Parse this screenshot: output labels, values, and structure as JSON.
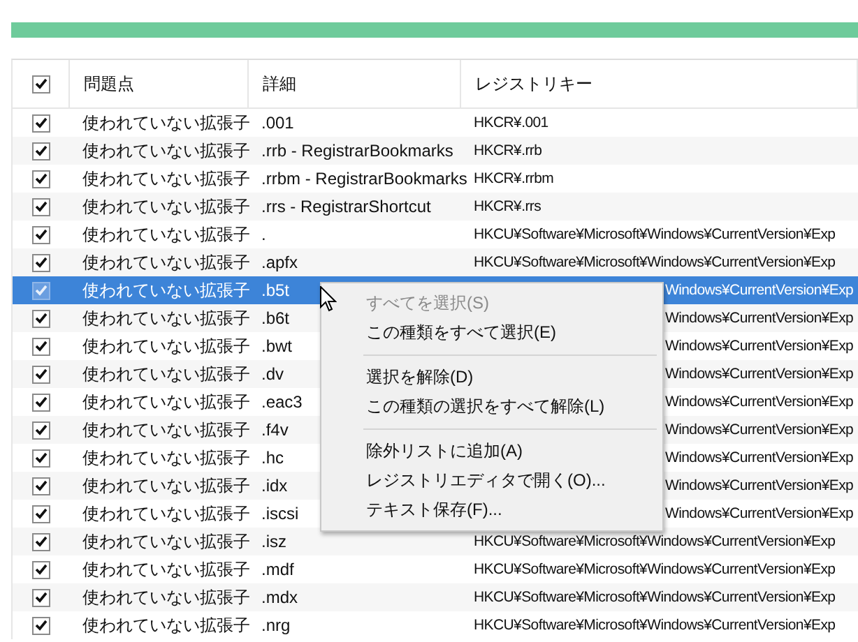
{
  "progress": {
    "level": 1
  },
  "table": {
    "header_checked": true,
    "columns": [
      "問題点",
      "詳細",
      "レジストリキー"
    ],
    "rows": [
      {
        "kind": "full",
        "checked": true,
        "selected": false,
        "problem": "使われていない拡張子",
        "detail": ".001",
        "key": "HKCR¥.001"
      },
      {
        "kind": "full",
        "checked": true,
        "selected": false,
        "problem": "使われていない拡張子",
        "detail": ".rrb - RegistrarBookmarks",
        "key": "HKCR¥.rrb"
      },
      {
        "kind": "full",
        "checked": true,
        "selected": false,
        "problem": "使われていない拡張子",
        "detail": ".rrbm - RegistrarBookmarks",
        "key": "HKCR¥.rrbm"
      },
      {
        "kind": "full",
        "checked": true,
        "selected": false,
        "problem": "使われていない拡張子",
        "detail": ".rrs - RegistrarShortcut",
        "key": "HKCR¥.rrs"
      },
      {
        "kind": "full",
        "checked": true,
        "selected": false,
        "problem": "使われていない拡張子",
        "detail": ".",
        "key": "HKCU¥Software¥Microsoft¥Windows¥CurrentVersion¥Exp"
      },
      {
        "kind": "full",
        "checked": true,
        "selected": false,
        "problem": "使われていない拡張子",
        "detail": ".apfx",
        "key": "HKCU¥Software¥Microsoft¥Windows¥CurrentVersion¥Exp"
      },
      {
        "kind": "covered",
        "checked": true,
        "selected": true,
        "problem": "使われていない拡張子",
        "detail": ".b5t",
        "key": "Windows¥CurrentVersion¥Exp"
      },
      {
        "kind": "covered",
        "checked": true,
        "selected": false,
        "problem": "使われていない拡張子",
        "detail": ".b6t",
        "key": "Windows¥CurrentVersion¥Exp"
      },
      {
        "kind": "covered",
        "checked": true,
        "selected": false,
        "problem": "使われていない拡張子",
        "detail": ".bwt",
        "key": "Windows¥CurrentVersion¥Exp"
      },
      {
        "kind": "covered",
        "checked": true,
        "selected": false,
        "problem": "使われていない拡張子",
        "detail": ".dv",
        "key": "Windows¥CurrentVersion¥Exp"
      },
      {
        "kind": "covered",
        "checked": true,
        "selected": false,
        "problem": "使われていない拡張子",
        "detail": ".eac3",
        "key": "Windows¥CurrentVersion¥Exp"
      },
      {
        "kind": "covered",
        "checked": true,
        "selected": false,
        "problem": "使われていない拡張子",
        "detail": ".f4v",
        "key": "Windows¥CurrentVersion¥Exp"
      },
      {
        "kind": "covered",
        "checked": true,
        "selected": false,
        "problem": "使われていない拡張子",
        "detail": ".hc",
        "key": "Windows¥CurrentVersion¥Exp"
      },
      {
        "kind": "covered",
        "checked": true,
        "selected": false,
        "problem": "使われていない拡張子",
        "detail": ".idx",
        "key": "Windows¥CurrentVersion¥Exp"
      },
      {
        "kind": "covered",
        "checked": true,
        "selected": false,
        "problem": "使われていない拡張子",
        "detail": ".iscsi",
        "key": "Windows¥CurrentVersion¥Exp"
      },
      {
        "kind": "full",
        "checked": true,
        "selected": false,
        "problem": "使われていない拡張子",
        "detail": ".isz",
        "key": "HKCU¥Software¥Microsoft¥Windows¥CurrentVersion¥Exp"
      },
      {
        "kind": "full",
        "checked": true,
        "selected": false,
        "problem": "使われていない拡張子",
        "detail": ".mdf",
        "key": "HKCU¥Software¥Microsoft¥Windows¥CurrentVersion¥Exp"
      },
      {
        "kind": "full",
        "checked": true,
        "selected": false,
        "problem": "使われていない拡張子",
        "detail": ".mdx",
        "key": "HKCU¥Software¥Microsoft¥Windows¥CurrentVersion¥Exp"
      },
      {
        "kind": "full",
        "checked": true,
        "selected": false,
        "problem": "使われていない拡張子",
        "detail": ".nrg",
        "key": "HKCU¥Software¥Microsoft¥Windows¥CurrentVersion¥Exp"
      }
    ]
  },
  "context_menu": [
    {
      "kind": "item",
      "label": "すべてを選択(S)",
      "disabled": true
    },
    {
      "kind": "item",
      "label": "この種類をすべて選択(E)",
      "disabled": false
    },
    {
      "kind": "separator"
    },
    {
      "kind": "item",
      "label": "選択を解除(D)",
      "disabled": false
    },
    {
      "kind": "item",
      "label": "この種類の選択をすべて解除(L)",
      "disabled": false
    },
    {
      "kind": "separator"
    },
    {
      "kind": "item",
      "label": "除外リストに追加(A)",
      "disabled": false
    },
    {
      "kind": "item",
      "label": "レジストリエディタで開く(O)...",
      "disabled": false
    },
    {
      "kind": "item",
      "label": "テキスト保存(F)...",
      "disabled": false
    }
  ]
}
